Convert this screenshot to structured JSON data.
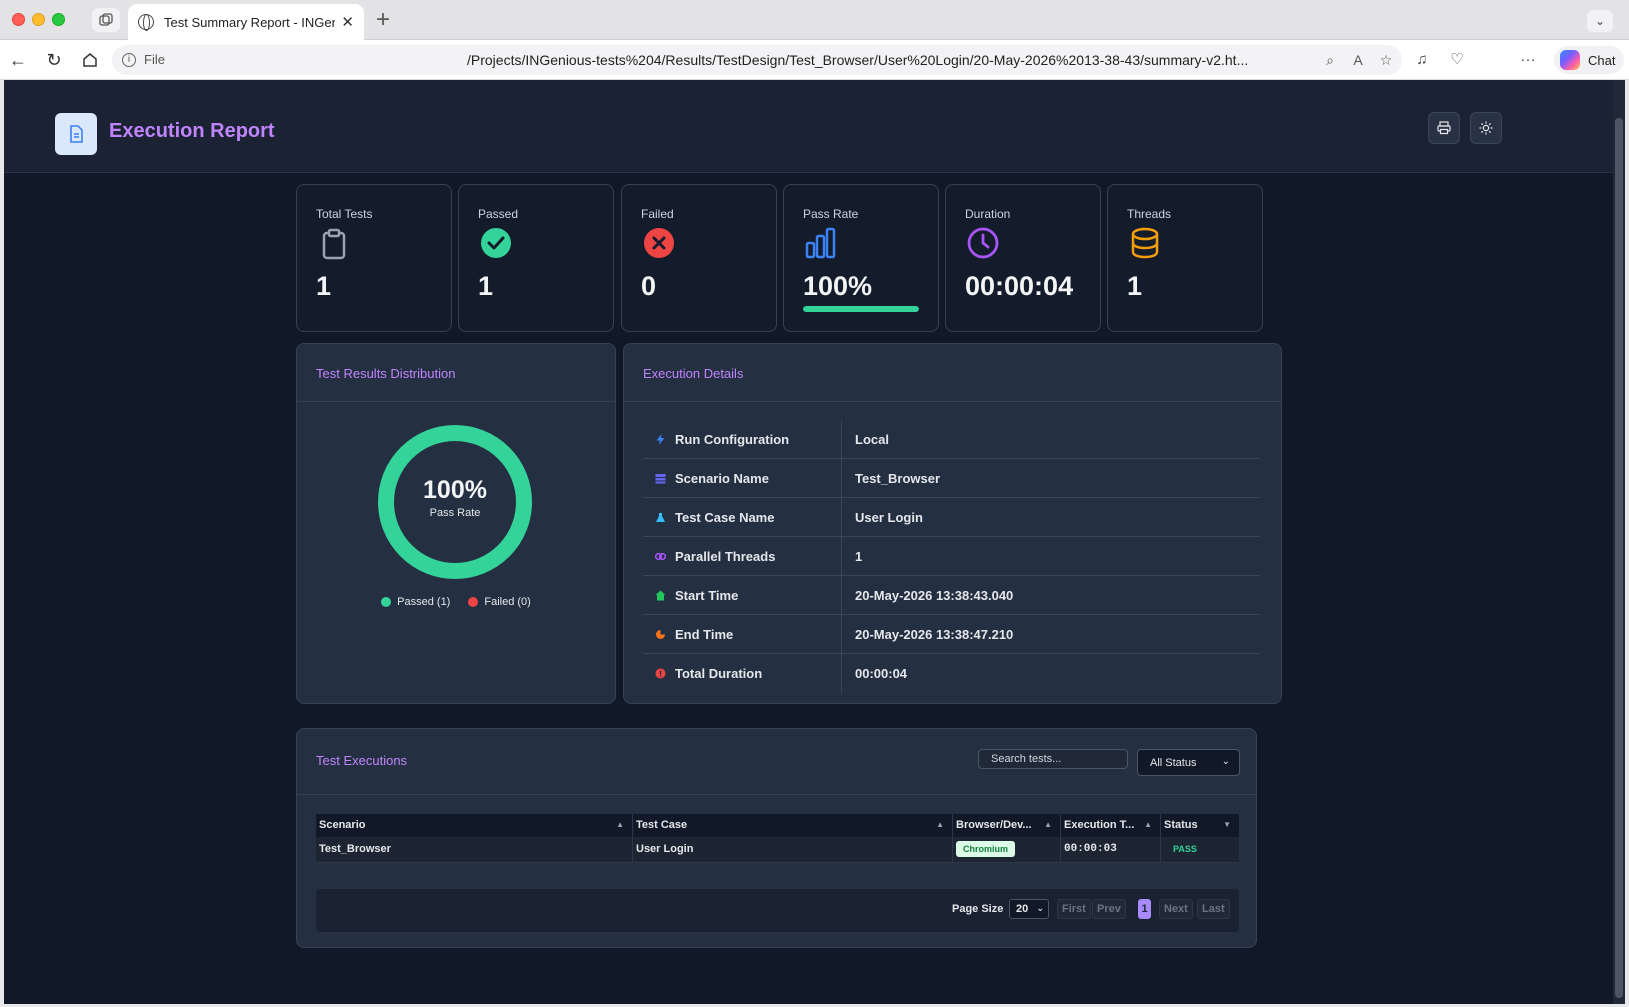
{
  "browser": {
    "tab_title": "Test Summary Report - INGenious",
    "url_scheme": "File",
    "url": "/Projects/INGenious-tests%204/Results/TestDesign/Test_Browser/User%20Login/20-May-2026%2013-38-43/summary-v2.ht...",
    "chat_label": "Chat"
  },
  "header": {
    "title": "Execution Report"
  },
  "stats": [
    {
      "label": "Total Tests",
      "value": "1",
      "icon": "clipboard-icon",
      "color": "#9ca3af"
    },
    {
      "label": "Passed",
      "value": "1",
      "icon": "check-circle-icon",
      "color": "#34d399"
    },
    {
      "label": "Failed",
      "value": "0",
      "icon": "x-circle-icon",
      "color": "#ef4444"
    },
    {
      "label": "Pass Rate",
      "value": "100%",
      "icon": "bar-chart-icon",
      "color": "#3b82f6",
      "progress_fraction": 1.0
    },
    {
      "label": "Duration",
      "value": "00:00:04",
      "icon": "clock-icon",
      "color": "#a855f7"
    },
    {
      "label": "Threads",
      "value": "1",
      "icon": "database-icon",
      "color": "#f59e0b"
    }
  ],
  "distribution": {
    "title": "Test Results Distribution",
    "center_value": "100%",
    "center_label": "Pass Rate",
    "legend": [
      {
        "label": "Passed (1)",
        "color": "#34d399"
      },
      {
        "label": "Failed (0)",
        "color": "#ef4444"
      }
    ]
  },
  "chart_data": {
    "type": "pie",
    "categories": [
      "Passed",
      "Failed"
    ],
    "values": [
      1,
      0
    ],
    "colors": [
      "#34d399",
      "#ef4444"
    ]
  },
  "execution_details": {
    "title": "Execution Details",
    "rows": [
      {
        "label": "Run Configuration",
        "value": "Local",
        "icon": "bolt-icon",
        "color": "#3b82f6"
      },
      {
        "label": "Scenario Name",
        "value": "Test_Browser",
        "icon": "layers-icon",
        "color": "#6366f1"
      },
      {
        "label": "Test Case Name",
        "value": "User Login",
        "icon": "flask-icon",
        "color": "#38bdf8"
      },
      {
        "label": "Parallel Threads",
        "value": "1",
        "icon": "link-icon",
        "color": "#a855f7"
      },
      {
        "label": "Start Time",
        "value": "20-May-2026 13:38:43.040",
        "icon": "home-icon",
        "color": "#22c55e"
      },
      {
        "label": "End Time",
        "value": "20-May-2026 13:38:47.210",
        "icon": "flag-icon",
        "color": "#f97316"
      },
      {
        "label": "Total Duration",
        "value": "00:00:04",
        "icon": "info-icon",
        "color": "#ef4444"
      }
    ]
  },
  "executions": {
    "title": "Test Executions",
    "search_placeholder": "Search tests...",
    "status_filter": "All Status",
    "columns": [
      "Scenario",
      "Test Case",
      "Browser/Dev...",
      "Execution T...",
      "Status"
    ],
    "rows": [
      {
        "scenario": "Test_Browser",
        "test_case": "User Login",
        "browser": "Chromium",
        "exec_time": "00:00:03",
        "status": "PASS"
      }
    ],
    "pager": {
      "page_size_label": "Page Size",
      "page_size": "20",
      "first": "First",
      "prev": "Prev",
      "current": "1",
      "next": "Next",
      "last": "Last"
    }
  }
}
